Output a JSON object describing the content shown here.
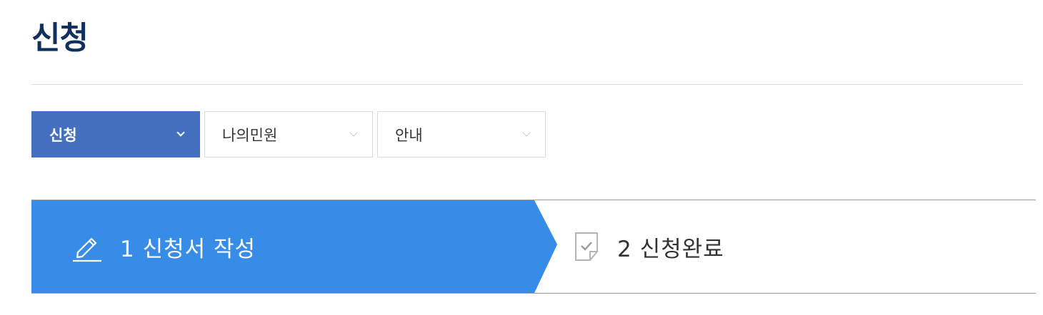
{
  "page": {
    "title": "신청"
  },
  "menu": {
    "tabs": [
      {
        "label": "신청",
        "active": true
      },
      {
        "label": "나의민원",
        "active": false
      },
      {
        "label": "안내",
        "active": false
      }
    ]
  },
  "steps": {
    "items": [
      {
        "label": "1 신청서 작성",
        "icon": "pencil-icon",
        "state": "current"
      },
      {
        "label": "2 신청완료",
        "icon": "document-check-icon",
        "state": "pending"
      }
    ]
  },
  "colors": {
    "title": "#12305f",
    "active_tab": "#4470bf",
    "current_step": "#368ce6"
  }
}
